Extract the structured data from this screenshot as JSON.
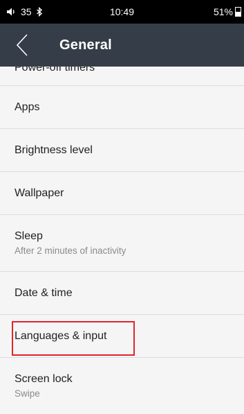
{
  "status_bar": {
    "volume_icon": "volume-icon",
    "volume_level": "35",
    "bluetooth_icon": "bluetooth-icon",
    "time": "10:49",
    "battery_percent": "51%",
    "battery_icon": "battery-charging-icon"
  },
  "header": {
    "back_icon": "chevron-left-icon",
    "title": "General"
  },
  "settings": {
    "items": [
      {
        "label": "Power-off timers",
        "subtitle": ""
      },
      {
        "label": "Apps",
        "subtitle": ""
      },
      {
        "label": "Brightness level",
        "subtitle": ""
      },
      {
        "label": "Wallpaper",
        "subtitle": ""
      },
      {
        "label": "Sleep",
        "subtitle": "After 2 minutes of inactivity"
      },
      {
        "label": "Date & time",
        "subtitle": ""
      },
      {
        "label": "Languages & input",
        "subtitle": ""
      },
      {
        "label": "Screen lock",
        "subtitle": "Swipe"
      }
    ]
  },
  "annotation": {
    "highlight_color": "#e0242a",
    "highlighted_item": "Languages & input"
  }
}
